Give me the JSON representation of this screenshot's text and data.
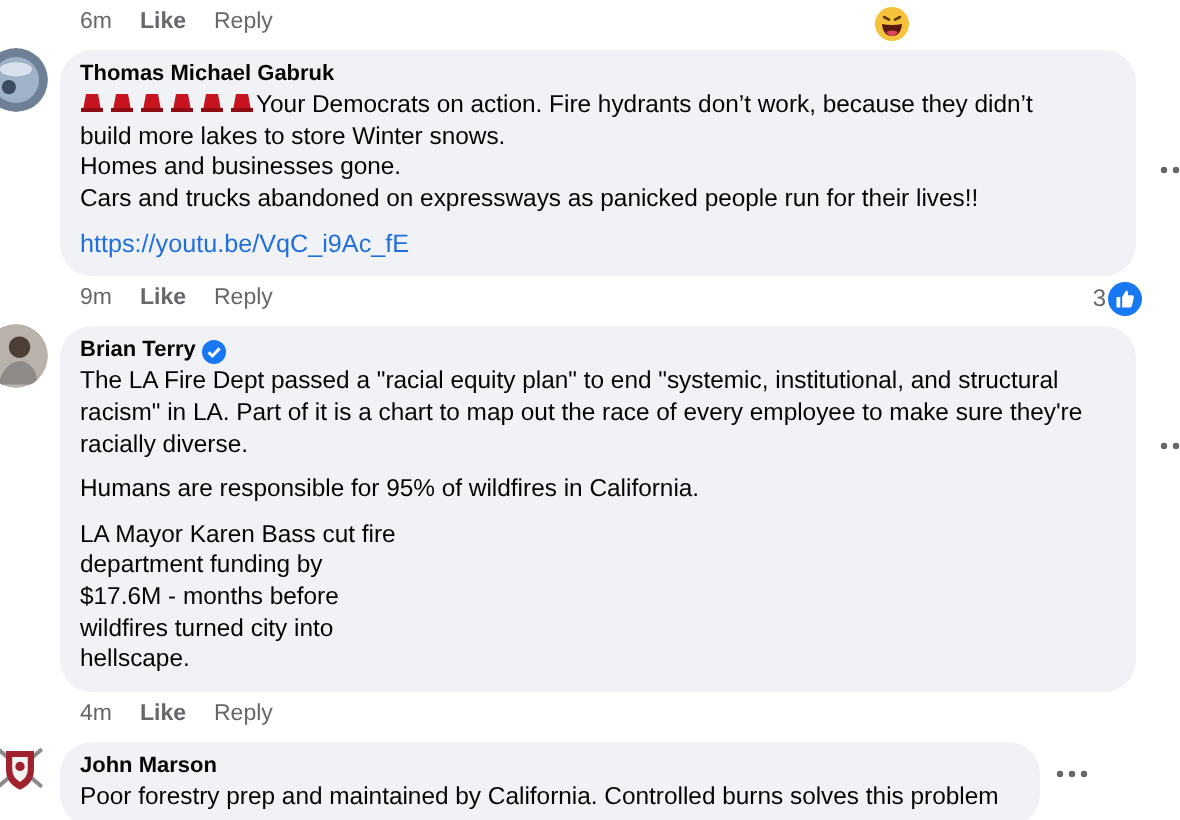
{
  "top_actions": {
    "time": "6m",
    "like": "Like",
    "reply": "Reply"
  },
  "comments": [
    {
      "author": "Thomas Michael Gabruk",
      "verified": false,
      "paragraphs": [
        [
          "Your Democrats on action. Fire hydrants don’t work, because they didn’t",
          "build more lakes to store Winter snows.",
          "Homes and businesses gone.",
          "Cars and trucks abandoned on expressways as panicked people run for their lives!!"
        ]
      ],
      "link": "https://youtu.be/VqC_i9Ac_fE",
      "time": "9m",
      "like": "Like",
      "reply": "Reply",
      "reaction_count": "3"
    },
    {
      "author": "Brian Terry",
      "verified": true,
      "paragraphs": [
        [
          "The LA Fire Dept passed a \"racial equity plan\" to end \"systemic, institutional, and structural racism\" in LA. Part of it is a chart to map out the race of every employee to make sure they're racially diverse."
        ],
        [
          "Humans are responsible for 95% of wildfires in California."
        ],
        [
          "LA Mayor Karen Bass cut fire",
          "department funding by",
          "$17.6M - months before",
          "wildfires turned city into",
          "hellscape."
        ]
      ],
      "time": "4m",
      "like": "Like",
      "reply": "Reply"
    },
    {
      "author": "John Marson",
      "verified": false,
      "paragraphs": [
        [
          "Poor forestry prep and maintained by California. Controlled burns solves this problem"
        ]
      ]
    }
  ]
}
